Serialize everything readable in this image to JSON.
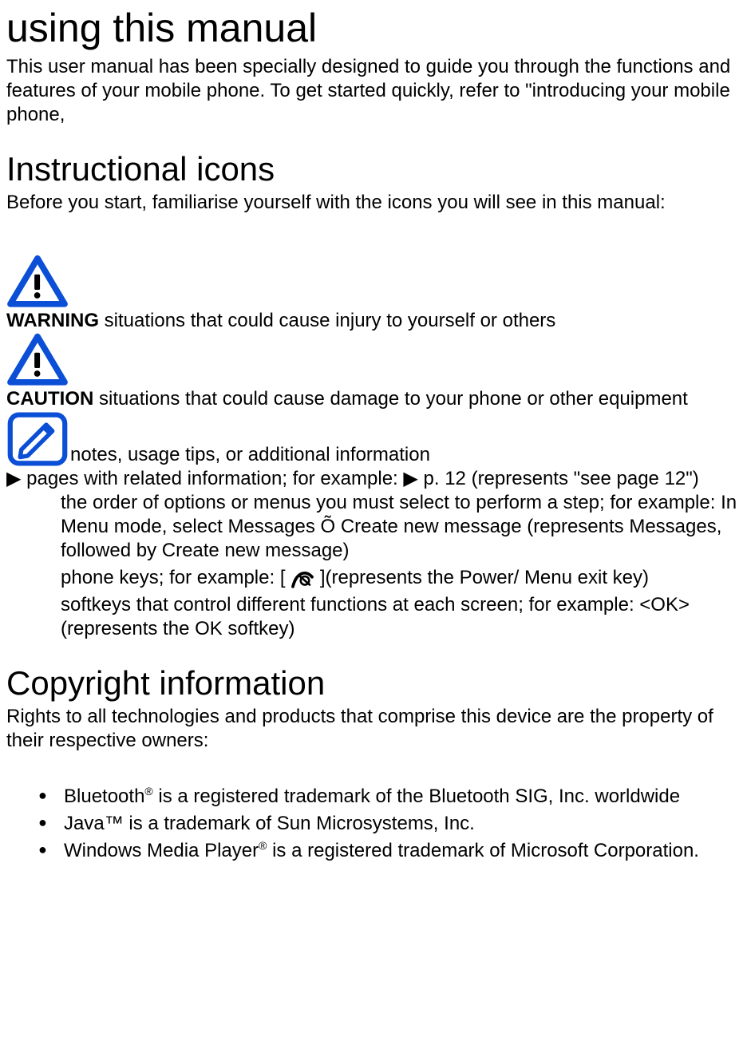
{
  "title_main": "using this manual",
  "intro_main": "This user manual has been specially designed to guide you through the functions and features of your mobile phone. To get started quickly, refer to \"introducing your mobile phone,",
  "heading_icons": "Instructional icons",
  "intro_icons": "Before you start, familiarise yourself with the icons you will see in this manual:",
  "warning": {
    "label": "WARNING",
    "text": " situations that could cause injury to yourself or others"
  },
  "caution": {
    "label": "CAUTION",
    "text": " situations that could cause damage to your phone or other equipment"
  },
  "note": {
    "text": "notes, usage tips, or additional information"
  },
  "related_line_prefix": "▶",
  "related_line": " pages with related information; for example: ",
  "related_line_arrow2": "▶",
  "related_line_tail": " p. 12 (represents \"see page 12\")",
  "order_line": "the order of options or menus you must select to perform a step; for example: In Menu mode, select Messages Õ Create new message (represents Messages, followed by Create new message)",
  "keys_line_a": "phone keys; for example: [",
  "keys_line_b": "](represents the Power/ Menu exit key)",
  "softkeys_line": "softkeys that control different functions at each screen; for example: <OK> (represents the OK softkey)",
  "heading_copyright": "Copyright information",
  "intro_copyright": "Rights to all technologies and products that comprise this device are the property of their respective owners:",
  "bullet1_a": "Bluetooth",
  "bullet1_sup": "®",
  "bullet1_b": " is a registered trademark of the Bluetooth SIG, Inc. worldwide",
  "bullet2": "Java™ is a trademark of Sun Microsystems, Inc.",
  "bullet3_a": "Windows Media Player",
  "bullet3_sup": "®",
  "bullet3_b": " is a registered trademark of Microsoft Corporation."
}
